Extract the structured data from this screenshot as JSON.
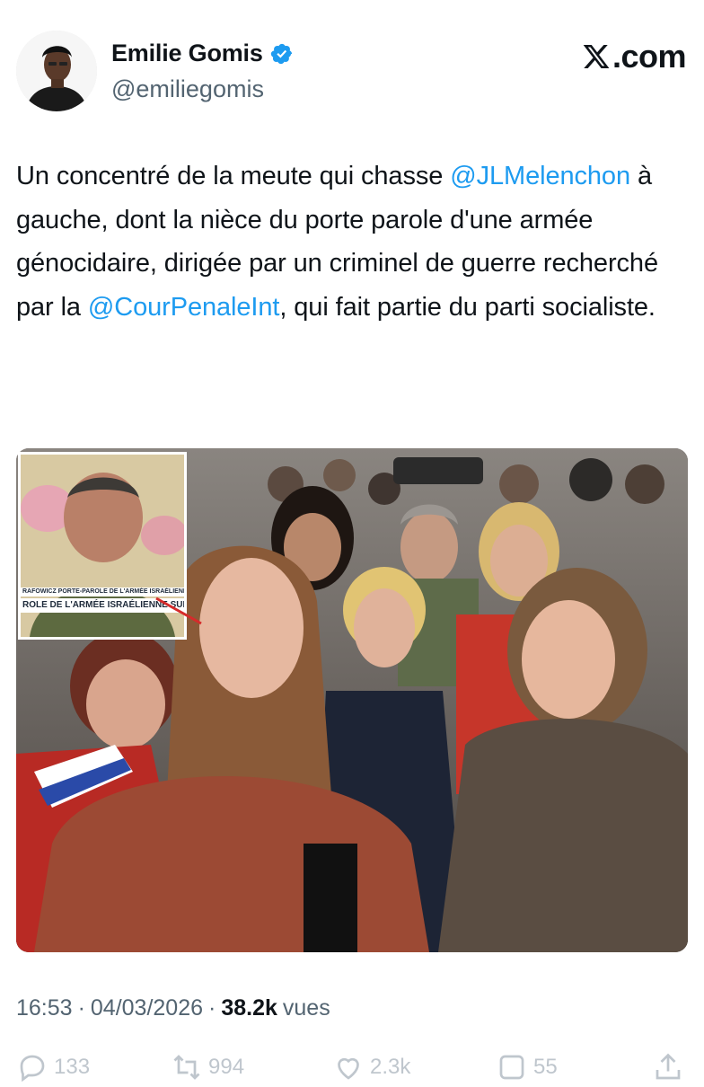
{
  "author": {
    "name": "Emilie Gomis",
    "handle": "@emiliegomis",
    "verified": true,
    "verified_color": "#1d9bf0"
  },
  "brand": {
    "label": ".com",
    "logo_icon": "x-logo-icon"
  },
  "tweet": {
    "parts": [
      {
        "text": "Un concentré de la meute qui chasse ",
        "type": "text"
      },
      {
        "text": "@JLMelenchon",
        "type": "mention"
      },
      {
        "text": " à gauche, dont la nièce du porte parole d'une armée génocidaire, dirigée par un criminel de guerre recherché par la ",
        "type": "text"
      },
      {
        "text": "@CourPenaleInt",
        "type": "mention"
      },
      {
        "text": ", qui fait partie du parti socialiste.",
        "type": "text"
      }
    ],
    "mention_color": "#1d9bf0"
  },
  "media": {
    "inset_caption_top": "RAFOWICZ  PORTE-PAROLE DE L'ARMÉE ISRAÉLIENNE",
    "inset_caption_bottom": "ROLE DE L'ARMÉE ISRAÉLIENNE SUR"
  },
  "meta": {
    "time": "16:53",
    "separator": "·",
    "date": "04/03/2026",
    "views_count": "38.2k",
    "views_label": "vues"
  },
  "actions": {
    "reply_count": "133",
    "retweet_count": "994",
    "like_count": "2.3k",
    "bookmark_count": "55"
  }
}
